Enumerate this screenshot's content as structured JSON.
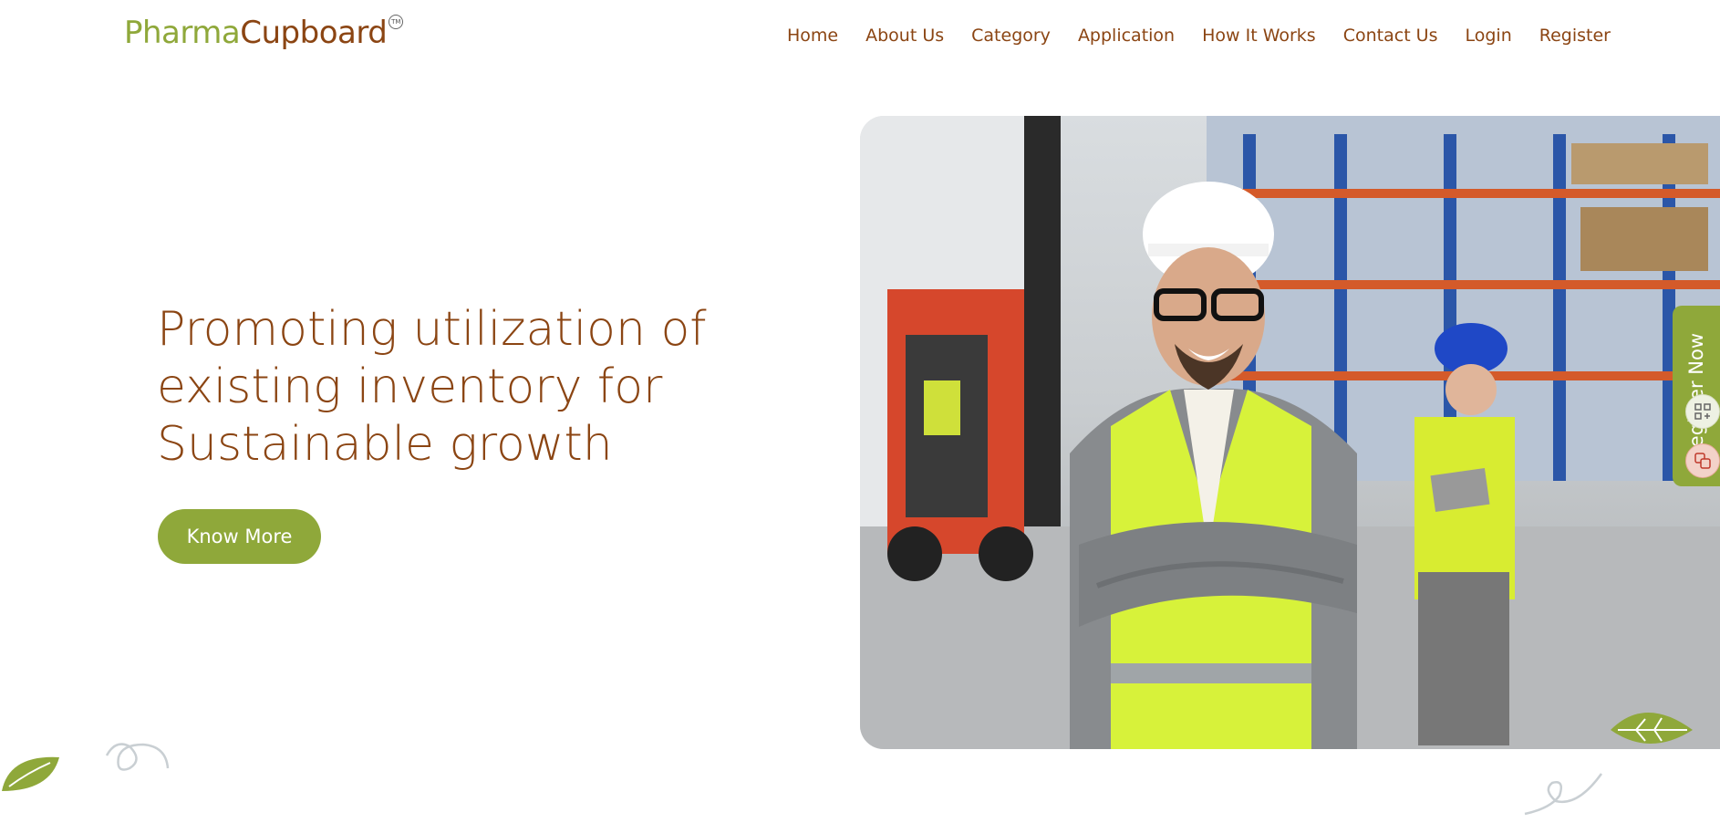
{
  "header": {
    "logo": {
      "part1": "Pharma",
      "part2": "Cupboard",
      "tm": "TM"
    },
    "nav": [
      {
        "label": "Home"
      },
      {
        "label": "About Us"
      },
      {
        "label": "Category"
      },
      {
        "label": "Application"
      },
      {
        "label": "How It Works"
      },
      {
        "label": "Contact Us"
      },
      {
        "label": "Login"
      },
      {
        "label": "Register"
      }
    ]
  },
  "hero": {
    "title_line1": "Promoting utilization of",
    "title_line2": "existing inventory for",
    "title_line3": "Sustainable growth",
    "button_label": "Know More"
  },
  "side_tab": {
    "label": "Register Now"
  },
  "colors": {
    "brand_green": "#8fa83a",
    "brand_brown": "#8b4513"
  },
  "icons": [
    "leaf-icon",
    "swirl-icon",
    "qr-icon",
    "translate-icon"
  ]
}
